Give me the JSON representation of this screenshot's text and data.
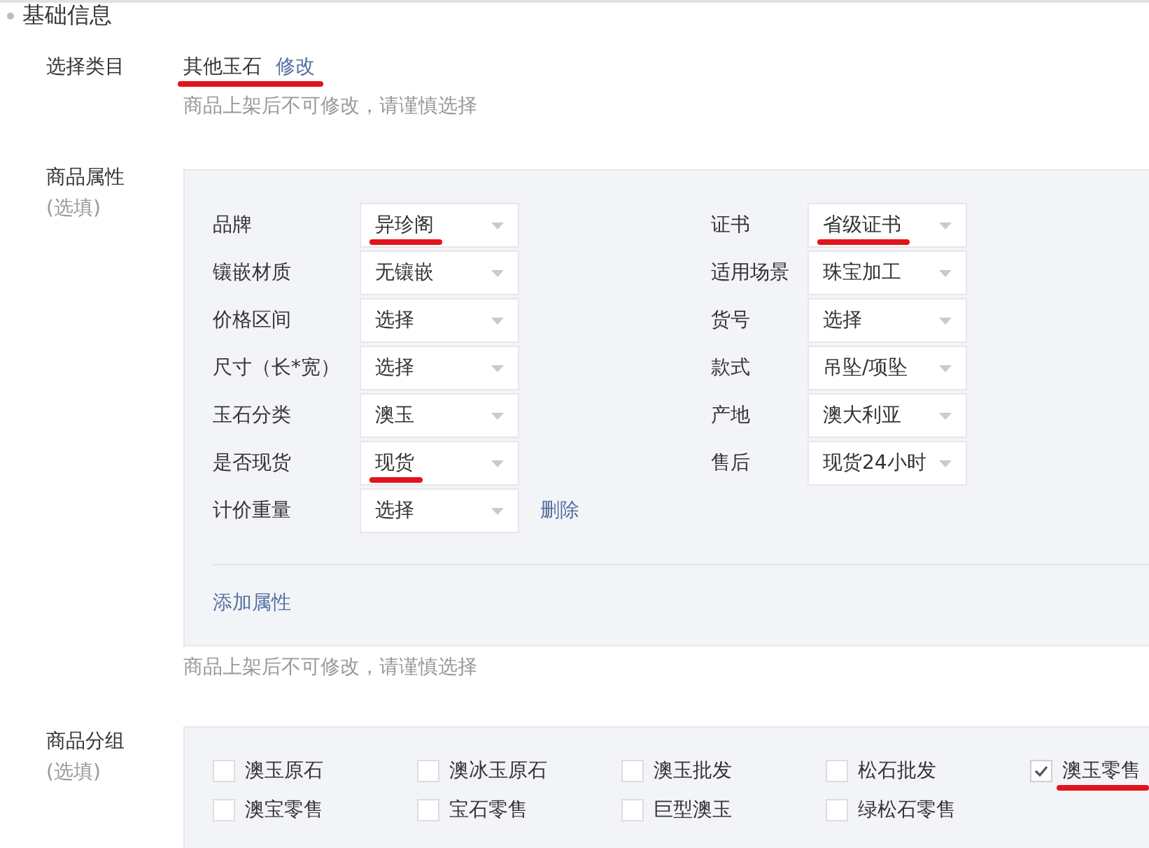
{
  "section": {
    "title": "基础信息"
  },
  "category": {
    "label": "选择类目",
    "value": "其他玉石",
    "link": "修改",
    "marked": true,
    "hint": "商品上架后不可修改，请谨慎选择"
  },
  "attributes": {
    "label": "商品属性",
    "optional": "(选填)",
    "columns": [
      [
        {
          "label": "品牌",
          "value": "异珍阁",
          "marked": true
        },
        {
          "label": "镶嵌材质",
          "value": "无镶嵌",
          "marked": false
        },
        {
          "label": "价格区间",
          "value": "选择",
          "marked": false
        },
        {
          "label": "尺寸（长*宽）",
          "value": "选择",
          "marked": false
        },
        {
          "label": "玉石分类",
          "value": "澳玉",
          "marked": false
        },
        {
          "label": "是否现货",
          "value": "现货",
          "marked": true
        },
        {
          "label": "计价重量",
          "value": "选择",
          "marked": false,
          "action": "删除"
        }
      ],
      [
        {
          "label": "证书",
          "value": "省级证书",
          "marked": true
        },
        {
          "label": "适用场景",
          "value": "珠宝加工",
          "marked": false
        },
        {
          "label": "货号",
          "value": "选择",
          "marked": false
        },
        {
          "label": "款式",
          "value": "吊坠/项坠",
          "marked": false
        },
        {
          "label": "产地",
          "value": "澳大利亚",
          "marked": false
        },
        {
          "label": "售后",
          "value": "现货24小时",
          "marked": false
        }
      ]
    ],
    "add_link": "添加属性",
    "hint": "商品上架后不可修改，请谨慎选择"
  },
  "groups": {
    "label": "商品分组",
    "optional": "(选填)",
    "options": [
      {
        "label": "澳玉原石",
        "checked": false,
        "marked": false
      },
      {
        "label": "澳冰玉原石",
        "checked": false,
        "marked": false
      },
      {
        "label": "澳玉批发",
        "checked": false,
        "marked": false
      },
      {
        "label": "松石批发",
        "checked": false,
        "marked": false
      },
      {
        "label": "澳玉零售",
        "checked": true,
        "marked": true
      },
      {
        "label": "澳宝零售",
        "checked": false,
        "marked": false
      },
      {
        "label": "宝石零售",
        "checked": false,
        "marked": false
      },
      {
        "label": "巨型澳玉",
        "checked": false,
        "marked": false
      },
      {
        "label": "绿松石零售",
        "checked": false,
        "marked": false
      }
    ]
  }
}
